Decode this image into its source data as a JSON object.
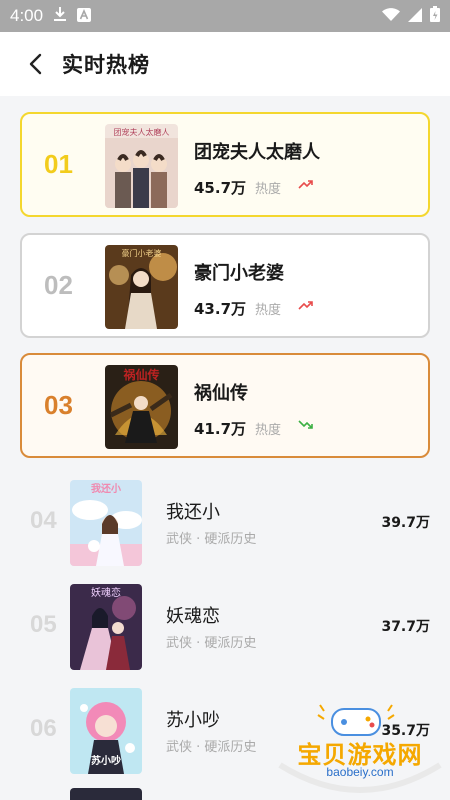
{
  "status_bar": {
    "time": "4:00",
    "icons": [
      "download-icon",
      "a-badge-icon",
      "wifi-icon",
      "cellular-icon",
      "battery-icon"
    ]
  },
  "header": {
    "title": "实时热榜",
    "back_icon": "back-arrow-icon"
  },
  "top_ranks": [
    {
      "rank": "01",
      "title": "团宠夫人太磨人",
      "heat": "45.7万",
      "heat_label": "热度",
      "trend": "up",
      "cover_text": "团宠夫人太磨人"
    },
    {
      "rank": "02",
      "title": "豪门小老婆",
      "heat": "43.7万",
      "heat_label": "热度",
      "trend": "up",
      "cover_text": "豪门小老婆"
    },
    {
      "rank": "03",
      "title": "祸仙传",
      "heat": "41.7万",
      "heat_label": "热度",
      "trend": "down",
      "cover_text": "祸仙传"
    }
  ],
  "list": [
    {
      "rank": "04",
      "title": "我还小",
      "tags": "武侠 · 硬派历史",
      "heat": "39.7万",
      "cover_text": "我还小"
    },
    {
      "rank": "05",
      "title": "妖魂恋",
      "tags": "武侠 · 硬派历史",
      "heat": "37.7万",
      "cover_text": "妖魂恋"
    },
    {
      "rank": "06",
      "title": "苏小吵",
      "tags": "武侠 · 硬派历史",
      "heat": "35.7万",
      "cover_text": "苏小吵"
    }
  ],
  "colors": {
    "rank1": "#f2cc1c",
    "rank2": "#bdbdbd",
    "rank3": "#d9802c",
    "trend_up": "#e84c4c",
    "trend_down": "#3cb043"
  },
  "watermark": {
    "text": "宝贝游戏网",
    "url": "baobeiy.com"
  }
}
